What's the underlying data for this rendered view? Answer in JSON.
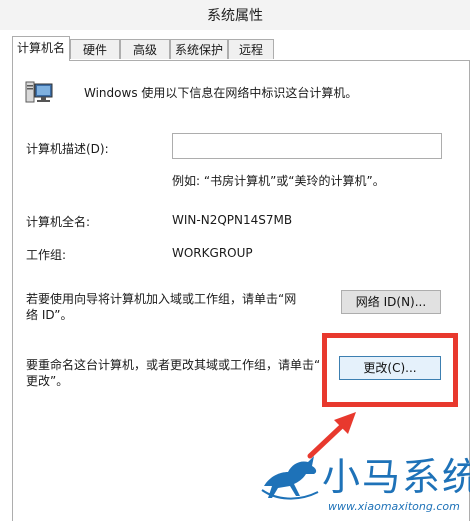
{
  "window": {
    "title": "系统属性"
  },
  "tabs": [
    {
      "label": "计算机名",
      "active": true
    },
    {
      "label": "硬件",
      "active": false
    },
    {
      "label": "高级",
      "active": false
    },
    {
      "label": "系统保护",
      "active": false
    },
    {
      "label": "远程",
      "active": false
    }
  ],
  "computer_name": {
    "intro_icon": "computer-monitor-icon",
    "intro_text": "Windows 使用以下信息在网络中标识这台计算机。",
    "description_label": "计算机描述(D):",
    "description_value": "",
    "example_text": "例如: “书房计算机”或“美玲的计算机”。",
    "full_name_label": "计算机全名:",
    "full_name_value": "WIN-N2QPN14S7MB",
    "workgroup_label": "工作组:",
    "workgroup_value": "WORKGROUP",
    "network_text_line1": "若要使用向导将计算机加入域或工作组，请单击“网",
    "network_text_line2": "络 ID”。",
    "network_id_button": "网络 ID(N)...",
    "rename_text_line1": "要重命名这台计算机，或者更改其域或工作组，请单击“",
    "rename_text_line2": "更改”。",
    "change_button": "更改(C)..."
  },
  "annotation": {
    "highlight_color": "#e8392e"
  },
  "watermark": {
    "brand": "小马系统",
    "site": "www.xiaomaxitong.com",
    "color": "#1e72b8"
  }
}
